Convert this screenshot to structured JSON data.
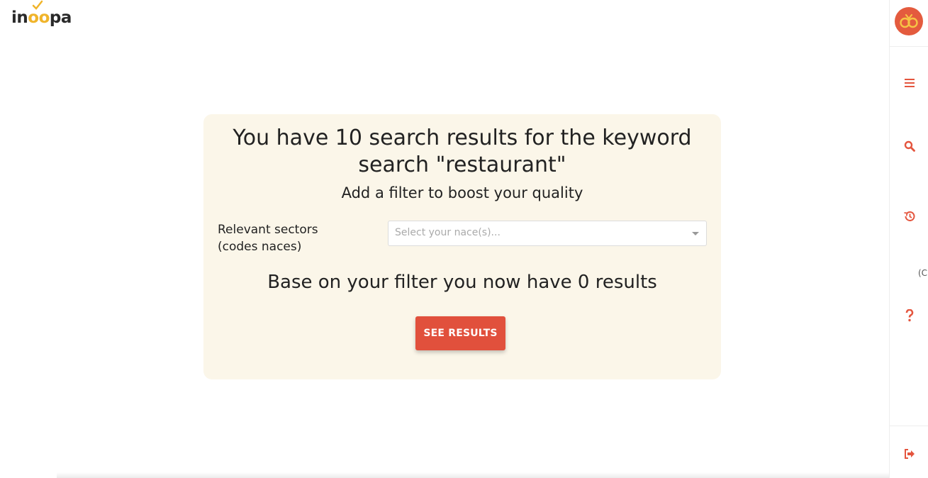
{
  "brand": {
    "name_prefix": "in",
    "name_mid": "oo",
    "name_suffix": "pa",
    "accent": "#f0b42a"
  },
  "sidebar": {
    "avatar_icon": "owl-logo-icon",
    "items": [
      {
        "name": "menu",
        "icon": "hamburger-icon"
      },
      {
        "name": "search",
        "icon": "search-icon"
      },
      {
        "name": "history",
        "icon": "history-icon"
      },
      {
        "name": "help",
        "icon": "question-icon"
      },
      {
        "name": "logout",
        "icon": "sign-out-icon"
      }
    ],
    "clipped_text": "(C",
    "icon_color": "#e4553e"
  },
  "card": {
    "headline": "You have 10 search results for the keyword search \"restaurant\"",
    "subline": "Add a filter to boost your quality",
    "filter": {
      "label": "Relevant sectors (codes naces)",
      "placeholder": "Select your nace(s)..."
    },
    "result_line": "Base on your filter you now have 0 results",
    "button_label": "SEE RESULTS",
    "button_color": "#e1503c",
    "background": "#fbf6e9"
  }
}
